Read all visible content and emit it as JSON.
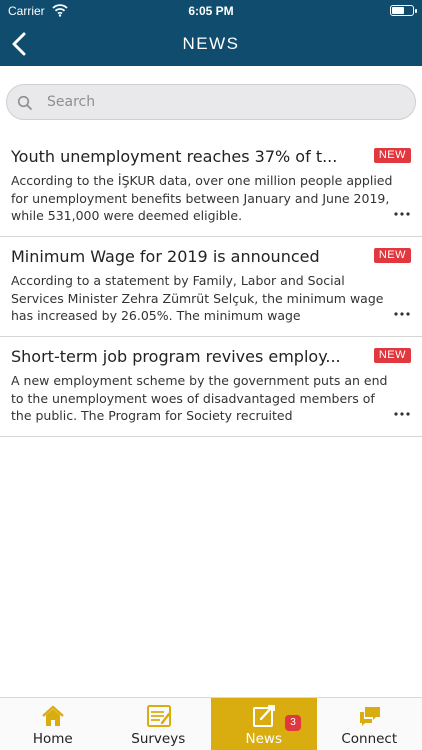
{
  "status_bar": {
    "carrier": "Carrier",
    "time": "6:05 PM"
  },
  "nav": {
    "title": "NEWS",
    "back_icon": "chevron-left-icon"
  },
  "search": {
    "placeholder": "Search",
    "value": ""
  },
  "news": [
    {
      "title": "Youth unemployment reaches 37% of t...",
      "badge": "NEW",
      "description": "According to the İŞKUR data, over one million people applied for unemployment benefits between January and June 2019, while 531,000 were deemed eligible."
    },
    {
      "title": "Minimum Wage for 2019 is announced",
      "badge": "NEW",
      "description": "According to a statement by Family, Labor and Social Services Minister Zehra Zümrüt Selçuk, the minimum wage has increased by 26.05%. The minimum wage"
    },
    {
      "title": "Short-term job program revives employ...",
      "badge": "NEW",
      "description": "A new employment scheme by the government puts an end to the unemployment woes of disadvantaged members of the public. The Program for Society recruited"
    }
  ],
  "tabs": [
    {
      "label": "Home",
      "icon": "home-icon",
      "active": false
    },
    {
      "label": "Surveys",
      "icon": "survey-icon",
      "active": false
    },
    {
      "label": "News",
      "icon": "news-icon",
      "active": true,
      "badge": "3"
    },
    {
      "label": "Connect",
      "icon": "chat-icon",
      "active": false
    }
  ],
  "colors": {
    "header_bg": "#0f4c6e",
    "accent": "#d9ad10",
    "badge_red": "#e0383e",
    "icon_gold": "#d9ad10"
  }
}
